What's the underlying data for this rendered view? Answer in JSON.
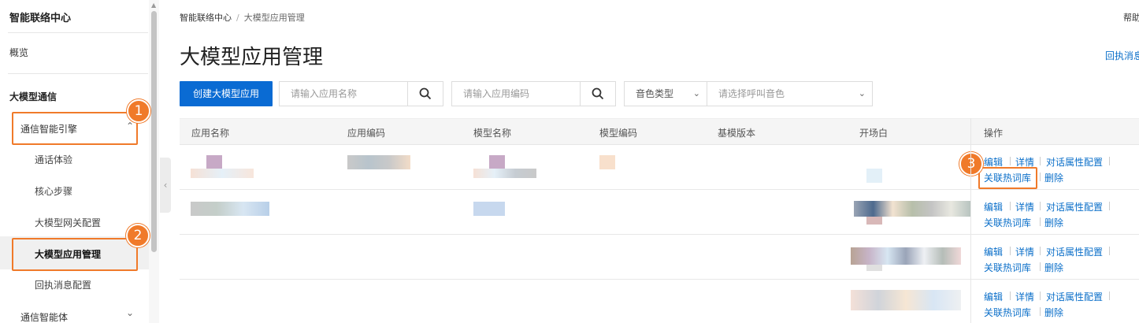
{
  "sidebar": {
    "title": "智能联络中心",
    "overview": "概览",
    "section": "大模型通信",
    "group_engine": "通信智能引擎",
    "sub_items": [
      "通话体验",
      "核心步骤",
      "大模型网关配置",
      "大模型应用管理",
      "回执消息配置"
    ],
    "group_agent": "通信智能体"
  },
  "breadcrumb": {
    "root": "智能联络中心",
    "separator": "/",
    "current": "大模型应用管理"
  },
  "help_label": "帮助",
  "page_title": "大模型应用管理",
  "top_link": "回执消息",
  "toolbar": {
    "create_label": "创建大模型应用",
    "app_name_placeholder": "请输入应用名称",
    "app_code_placeholder": "请输入应用编码",
    "voice_type": "音色类型",
    "voice_select_placeholder": "请选择呼叫音色"
  },
  "table": {
    "headers": [
      "应用名称",
      "应用编码",
      "模型名称",
      "模型编码",
      "基模版本",
      "开场白",
      "操作"
    ],
    "actions": {
      "edit": "编辑",
      "detail": "详情",
      "dialog_attr": "对话属性配置",
      "hotword": "关联热词库",
      "delete": "删除"
    }
  },
  "annotations": [
    "1",
    "2",
    "3"
  ],
  "colors": {
    "primary": "#0a6bd3",
    "link": "#0b6fc9",
    "annotation": "#f07a2a"
  }
}
